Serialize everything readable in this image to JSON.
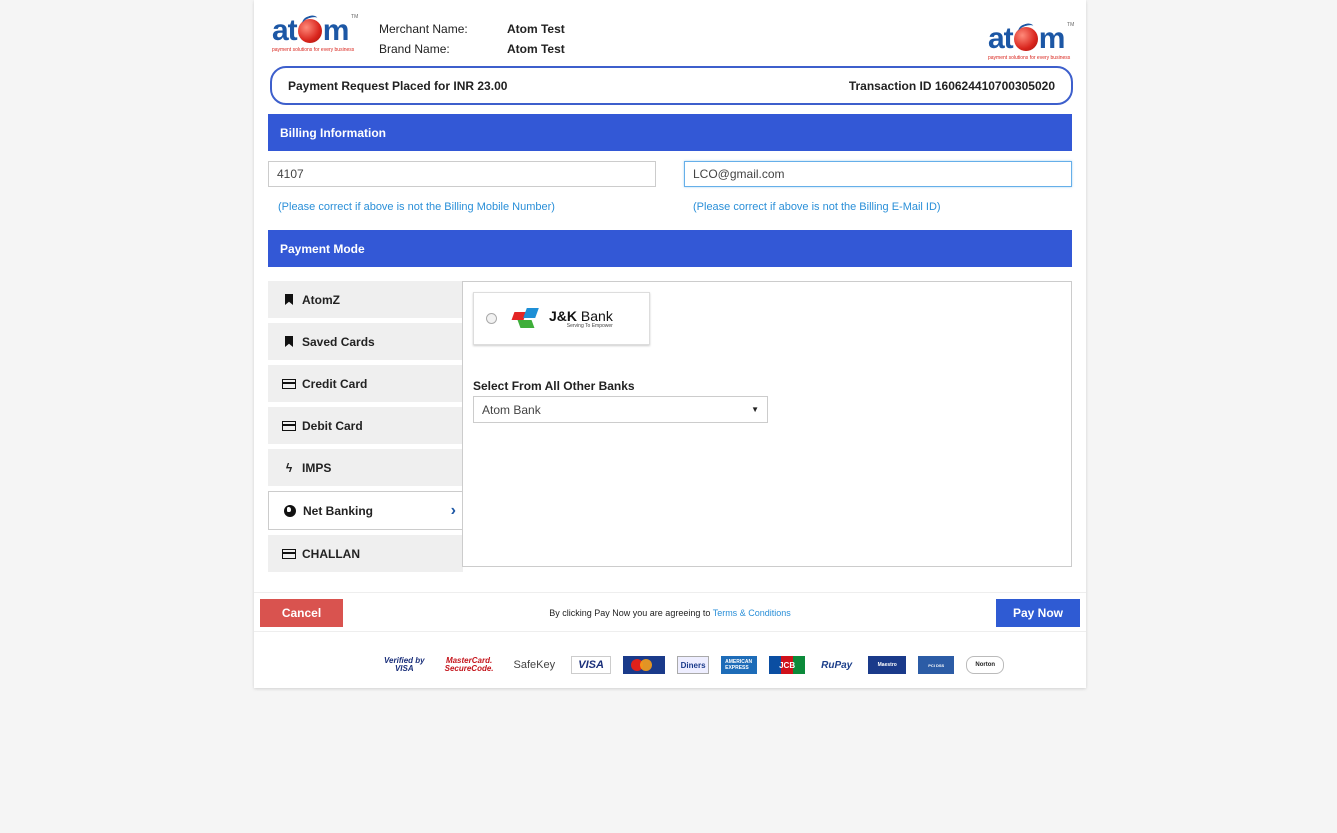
{
  "header": {
    "logo_text_left": "at",
    "logo_text_right": "m",
    "logo_tagline": "payment solutions for every business",
    "logo_tm": "TM",
    "merchant_label": "Merchant Name:",
    "merchant_value": "Atom Test",
    "brand_label": "Brand Name:",
    "brand_value": "Atom Test"
  },
  "request": {
    "amount_text": "Payment Request Placed for INR  23.00",
    "transaction_text": "Transaction ID  160624410700305020"
  },
  "billing": {
    "title": "Billing Information",
    "mobile_value": "4107",
    "email_value": "LCO@gmail.com",
    "mobile_hint": "(Please correct if above is not the Billing Mobile Number)",
    "email_hint": "(Please correct if above is not the Billing E-Mail ID)"
  },
  "payment_mode": {
    "title": "Payment Mode",
    "tabs": [
      {
        "label": "AtomZ",
        "icon": "bookmark-icon"
      },
      {
        "label": "Saved Cards",
        "icon": "bookmark-icon"
      },
      {
        "label": "Credit Card",
        "icon": "credit-card-icon"
      },
      {
        "label": "Debit Card",
        "icon": "credit-card-icon"
      },
      {
        "label": "IMPS",
        "icon": "bolt-icon"
      },
      {
        "label": "Net Banking",
        "icon": "globe-icon",
        "active": true
      },
      {
        "label": "CHALLAN",
        "icon": "credit-card-icon"
      }
    ],
    "bank_option": {
      "name_bold": "J&K",
      "name_rest": " Bank",
      "tagline": "Serving To Empower"
    },
    "select_label": "Select From All Other Banks",
    "select_value": "Atom Bank"
  },
  "footer": {
    "cancel_label": "Cancel",
    "pay_label": "Pay Now",
    "agree_prefix": "By clicking Pay Now you are agreeing to ",
    "agree_link": "Terms & Conditions"
  },
  "payment_logos": {
    "vbv_top": "Verified by",
    "vbv_bottom": "VISA",
    "msc_top": "MasterCard.",
    "msc_bottom": "SecureCode.",
    "safekey": "SafeKey",
    "visa": "VISA",
    "diners": "Diners",
    "amex": "AMERICAN EXPRESS",
    "jcb": "JCB",
    "rupay": "RuPay",
    "maestro": "Maestro",
    "pci": "PCI DSS",
    "norton": "Norton"
  },
  "colors": {
    "primary_bar": "#3358d6",
    "cancel": "#d9534f",
    "pay": "#2f5bd3",
    "hint": "#2a8fd8"
  }
}
